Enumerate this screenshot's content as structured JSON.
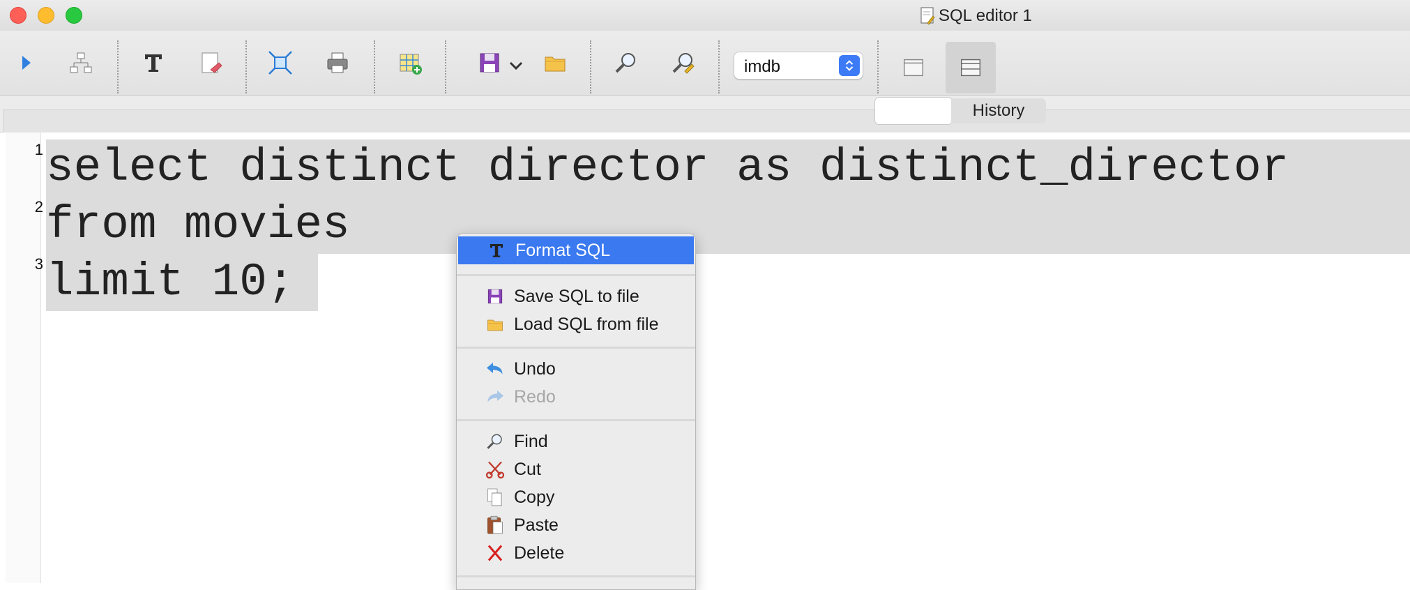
{
  "window": {
    "title": "SQL editor 1"
  },
  "toolbar": {
    "buttons": [
      {
        "icon": "execute-icon"
      },
      {
        "icon": "explain-plan-icon"
      },
      {
        "icon": "format-sql-icon"
      },
      {
        "icon": "clear-icon"
      },
      {
        "icon": "expand-icon"
      },
      {
        "icon": "print-icon"
      },
      {
        "icon": "new-table-icon"
      },
      {
        "icon": "save-icon"
      },
      {
        "icon": "open-folder-icon"
      },
      {
        "icon": "find-icon"
      },
      {
        "icon": "find-replace-icon"
      }
    ],
    "database": "imdb"
  },
  "tabs": {
    "history_label": "History"
  },
  "editor": {
    "line_numbers": [
      "1",
      "2",
      "3"
    ],
    "lines": [
      "select distinct director as distinct_director",
      "from movies",
      "limit 10;"
    ]
  },
  "context_menu": {
    "items": [
      {
        "label": "Format SQL",
        "icon": "format-sql-icon",
        "highlighted": true
      },
      {
        "label": "Save SQL to file",
        "icon": "save-icon"
      },
      {
        "label": "Load SQL from file",
        "icon": "open-folder-icon"
      },
      {
        "label": "Undo",
        "icon": "undo-icon"
      },
      {
        "label": "Redo",
        "icon": "redo-icon",
        "disabled": true
      },
      {
        "label": "Find",
        "icon": "find-icon"
      },
      {
        "label": "Cut",
        "icon": "cut-icon"
      },
      {
        "label": "Copy",
        "icon": "copy-icon"
      },
      {
        "label": "Paste",
        "icon": "paste-icon"
      },
      {
        "label": "Delete",
        "icon": "delete-icon"
      }
    ]
  },
  "colors": {
    "highlight": "#3a79f0",
    "selection": "#dcdcdc",
    "stepper": "#3d7bf6"
  }
}
